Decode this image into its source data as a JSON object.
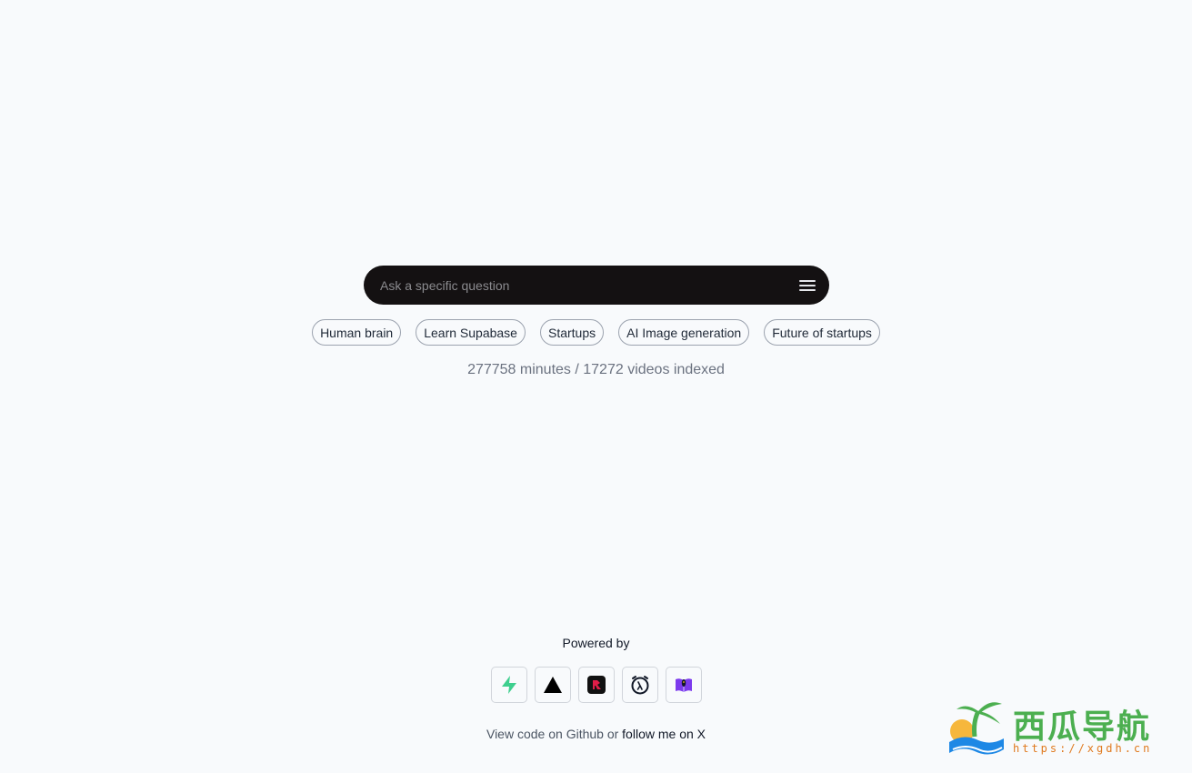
{
  "search": {
    "placeholder": "Ask a specific question",
    "menu_icon": "hamburger-menu-icon"
  },
  "suggestions": [
    "Human brain",
    "Learn Supabase",
    "Startups",
    "AI Image generation",
    "Future of startups"
  ],
  "stats": {
    "text": "277758 minutes / 17272 videos indexed"
  },
  "footer": {
    "powered_by": "Powered by",
    "logos": [
      {
        "icon": "supabase-icon",
        "color": "#3ecf8e"
      },
      {
        "icon": "vercel-icon",
        "color": "#000000"
      },
      {
        "icon": "replicate-icon",
        "color": "#e11d48"
      },
      {
        "icon": "openai-clock-icon",
        "color": "#111827"
      },
      {
        "icon": "purple-app-icon",
        "color": "#7c3aed"
      }
    ],
    "view_code_prefix": "View code on ",
    "github_label": "Github",
    "or_label": " or ",
    "follow_label": "follow me on X"
  },
  "watermark": {
    "title": "西瓜导航",
    "url": "https://xgdh.cn"
  }
}
